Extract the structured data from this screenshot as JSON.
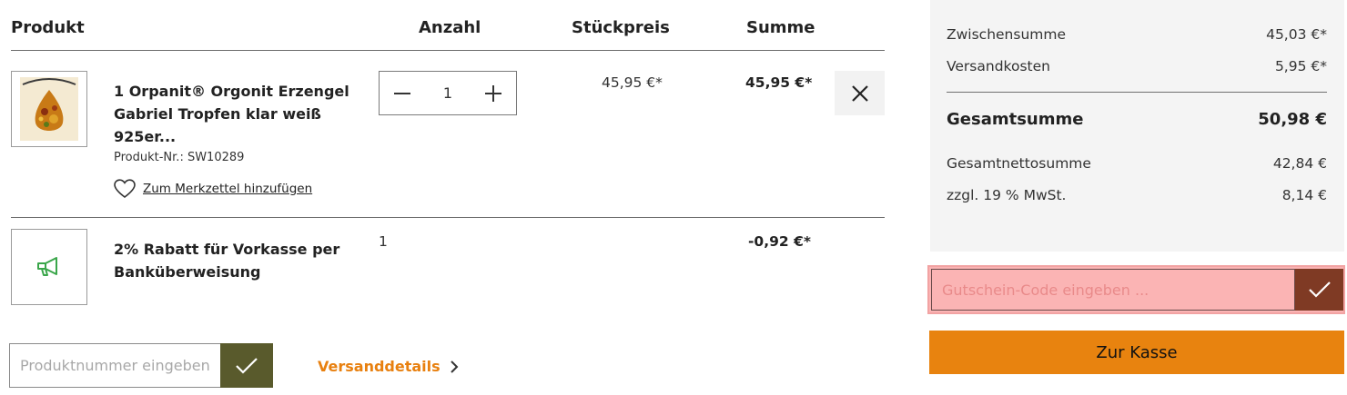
{
  "table": {
    "headers": {
      "product": "Produkt",
      "quantity": "Anzahl",
      "unit_price": "Stückpreis",
      "total": "Summe"
    }
  },
  "items": [
    {
      "name_lines": [
        "1 Orpanit® Orgonit Erzengel",
        "Gabriel Tropfen klar weiß",
        "925er..."
      ],
      "product_number": "Produkt-Nr.: SW10289",
      "wishlist_label": "Zum Merkzettel hinzufügen",
      "quantity": "1",
      "unit_price": "45,95 €*",
      "total": "45,95 €*",
      "thumbnail_icon": "amber-pendant-image"
    },
    {
      "name_lines": [
        "2% Rabatt für Vorkasse per",
        "Banküberweisung"
      ],
      "quantity": "1",
      "total": "-0,92 €*",
      "thumbnail_icon": "megaphone-icon"
    }
  ],
  "add_product": {
    "placeholder": "Produktnummer eingeben",
    "button_icon": "check-icon"
  },
  "shipping_link": "Versanddetails",
  "summary": {
    "subtotal_label": "Zwischensumme",
    "subtotal_value": "45,03 €*",
    "shipping_label": "Versandkosten",
    "shipping_value": "5,95 €*",
    "grand_total_label": "Gesamtsumme",
    "grand_total_value": "50,98 €",
    "net_total_label": "Gesamtnettosumme",
    "net_total_value": "42,84 €",
    "vat_label": "zzgl. 19 % MwSt.",
    "vat_value": "8,14 €"
  },
  "voucher": {
    "placeholder": "Gutschein-Code eingeben ..."
  },
  "checkout_label": "Zur Kasse",
  "colors": {
    "accent": "#e8830f",
    "add_button": "#595a2c",
    "voucher_button": "#7f3a24",
    "voucher_highlight": "#fbb4b4",
    "discount_icon": "#3aa64a"
  }
}
